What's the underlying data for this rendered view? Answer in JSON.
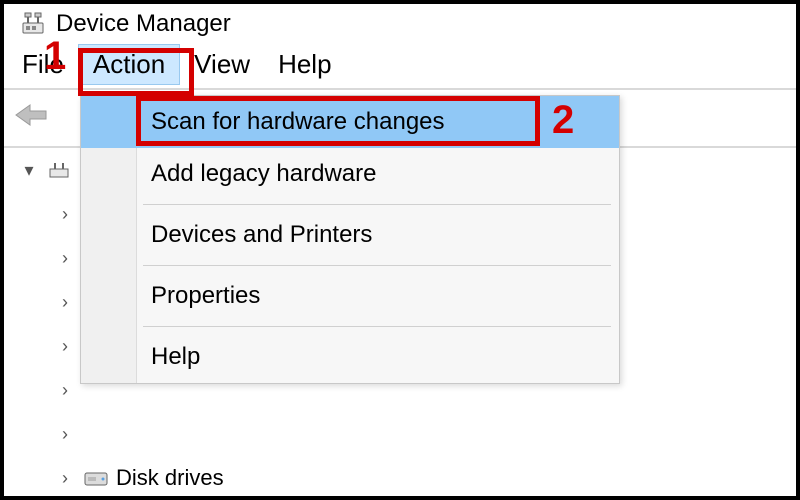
{
  "window": {
    "title": "Device Manager"
  },
  "menubar": {
    "file": "File",
    "action": "Action",
    "view": "View",
    "help": "Help"
  },
  "action_menu": {
    "scan": "Scan for hardware changes",
    "add_legacy": "Add legacy hardware",
    "devices_printers": "Devices and Printers",
    "properties": "Properties",
    "help": "Help"
  },
  "tree": {
    "disk_drives": "Disk drives"
  },
  "annotations": {
    "one": "1",
    "two": "2"
  }
}
